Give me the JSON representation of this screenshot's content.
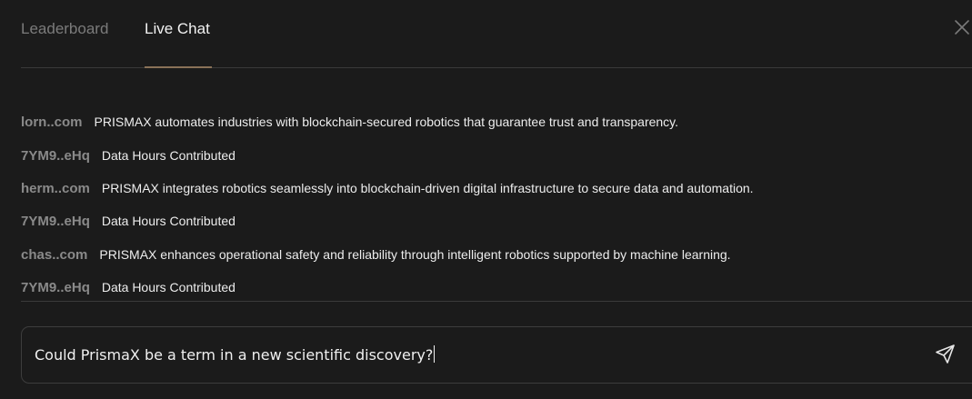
{
  "tabs": [
    {
      "label": "Leaderboard",
      "active": false
    },
    {
      "label": "Live Chat",
      "active": true
    }
  ],
  "colors": {
    "background": "#1b1b1b",
    "active_tab_underline": "#8a7258",
    "username": "#8a8a8a",
    "message_text": "#ededed"
  },
  "icons": {
    "close": "close-icon",
    "send": "send-icon"
  },
  "chat": {
    "messages": [
      {
        "user": "lorn..com",
        "text": "PRISMAX automates industries with blockchain-secured robotics that guarantee trust and transparency."
      },
      {
        "user": "7YM9..eHq",
        "text": "Data Hours Contributed"
      },
      {
        "user": "herm..com",
        "text": "PRISMAX integrates robotics seamlessly into blockchain-driven digital infrastructure to secure data and automation."
      },
      {
        "user": "7YM9..eHq",
        "text": "Data Hours Contributed"
      },
      {
        "user": "chas..com",
        "text": "PRISMAX enhances operational safety and reliability through intelligent robotics supported by machine learning."
      },
      {
        "user": "7YM9..eHq",
        "text": "Data Hours Contributed"
      }
    ]
  },
  "composer": {
    "value": "Could PrismaX be a term in a new scientific discovery?"
  }
}
